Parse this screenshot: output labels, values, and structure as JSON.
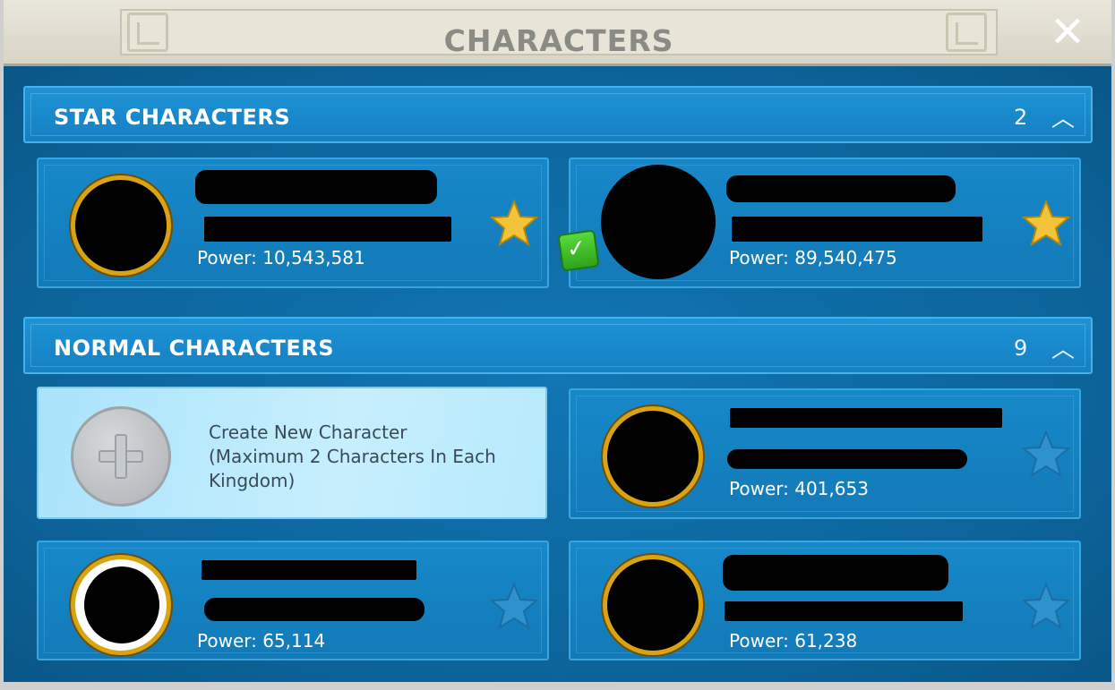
{
  "window": {
    "title": "CHARACTERS",
    "close_icon": "close-icon"
  },
  "sections": {
    "star": {
      "title": "STAR CHARACTERS",
      "count": "2",
      "toggle_icon": "chevron-up-icon"
    },
    "normal": {
      "title": "NORMAL CHARACTERS",
      "count": "9",
      "toggle_icon": "chevron-up-icon"
    }
  },
  "star_characters": [
    {
      "power": "Power: 10,543,581",
      "starred": true
    },
    {
      "power": "Power: 89,540,475",
      "starred": true,
      "selected": true
    }
  ],
  "create_character": {
    "line1": "Create New Character",
    "line2": "(Maximum 2 Characters In Each",
    "line3": "Kingdom)"
  },
  "normal_characters": [
    {
      "power": "Power: 401,653",
      "starred": false
    },
    {
      "power": "Power: 65,114",
      "starred": false
    },
    {
      "power": "Power: 61,238",
      "starred": false
    }
  ],
  "colors": {
    "background": "#0d5d8f",
    "header": "#1a8acb",
    "star_active": "#f3c437",
    "star_inactive": "#2f91cd",
    "avatar_ring": "#d8a412",
    "check": "#3ebd22"
  }
}
